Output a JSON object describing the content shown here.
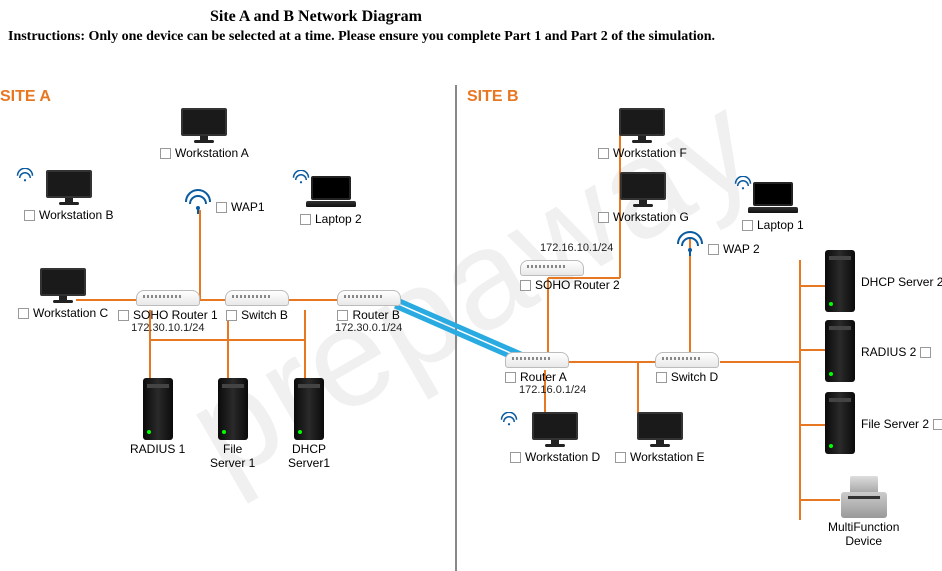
{
  "title": "Site A and B Network Diagram",
  "instructions": "Instructions: Only one device can be selected at a time. Please ensure you complete Part 1 and Part 2 of the simulation.",
  "watermark": "prepaway",
  "site_a": {
    "label": "SITE A"
  },
  "site_b": {
    "label": "SITE B"
  },
  "devices": {
    "workstation_a": {
      "label": "Workstation A"
    },
    "workstation_b": {
      "label": "Workstation B"
    },
    "workstation_c": {
      "label": "Workstation C"
    },
    "workstation_d": {
      "label": "Workstation D"
    },
    "workstation_e": {
      "label": "Workstation E"
    },
    "workstation_f": {
      "label": "Workstation F"
    },
    "workstation_g": {
      "label": "Workstation G"
    },
    "laptop_1": {
      "label": "Laptop 1"
    },
    "laptop_2": {
      "label": "Laptop 2"
    },
    "wap_1": {
      "label": "WAP1"
    },
    "wap_2": {
      "label": "WAP 2"
    },
    "soho_router_1": {
      "label": "SOHO Router 1",
      "ip": "172.30.10.1/24"
    },
    "soho_router_2": {
      "label": "SOHO Router 2",
      "ip": "172.16.10.1/24"
    },
    "switch_b": {
      "label": "Switch B"
    },
    "switch_d": {
      "label": "Switch D"
    },
    "router_a": {
      "label": "Router A",
      "ip": "172.16.0.1/24"
    },
    "router_b": {
      "label": "Router B",
      "ip": "172.30.0.1/24"
    },
    "radius_1": {
      "label": "RADIUS 1"
    },
    "radius_2": {
      "label": "RADIUS 2"
    },
    "file_server_1": {
      "label": "File\nServer 1"
    },
    "file_server_2": {
      "label": "File Server 2"
    },
    "dhcp_server_1": {
      "label": "DHCP\nServer1"
    },
    "dhcp_server_2": {
      "label": "DHCP Server 2"
    },
    "multifunction": {
      "label": "MultiFunction\nDevice"
    }
  }
}
